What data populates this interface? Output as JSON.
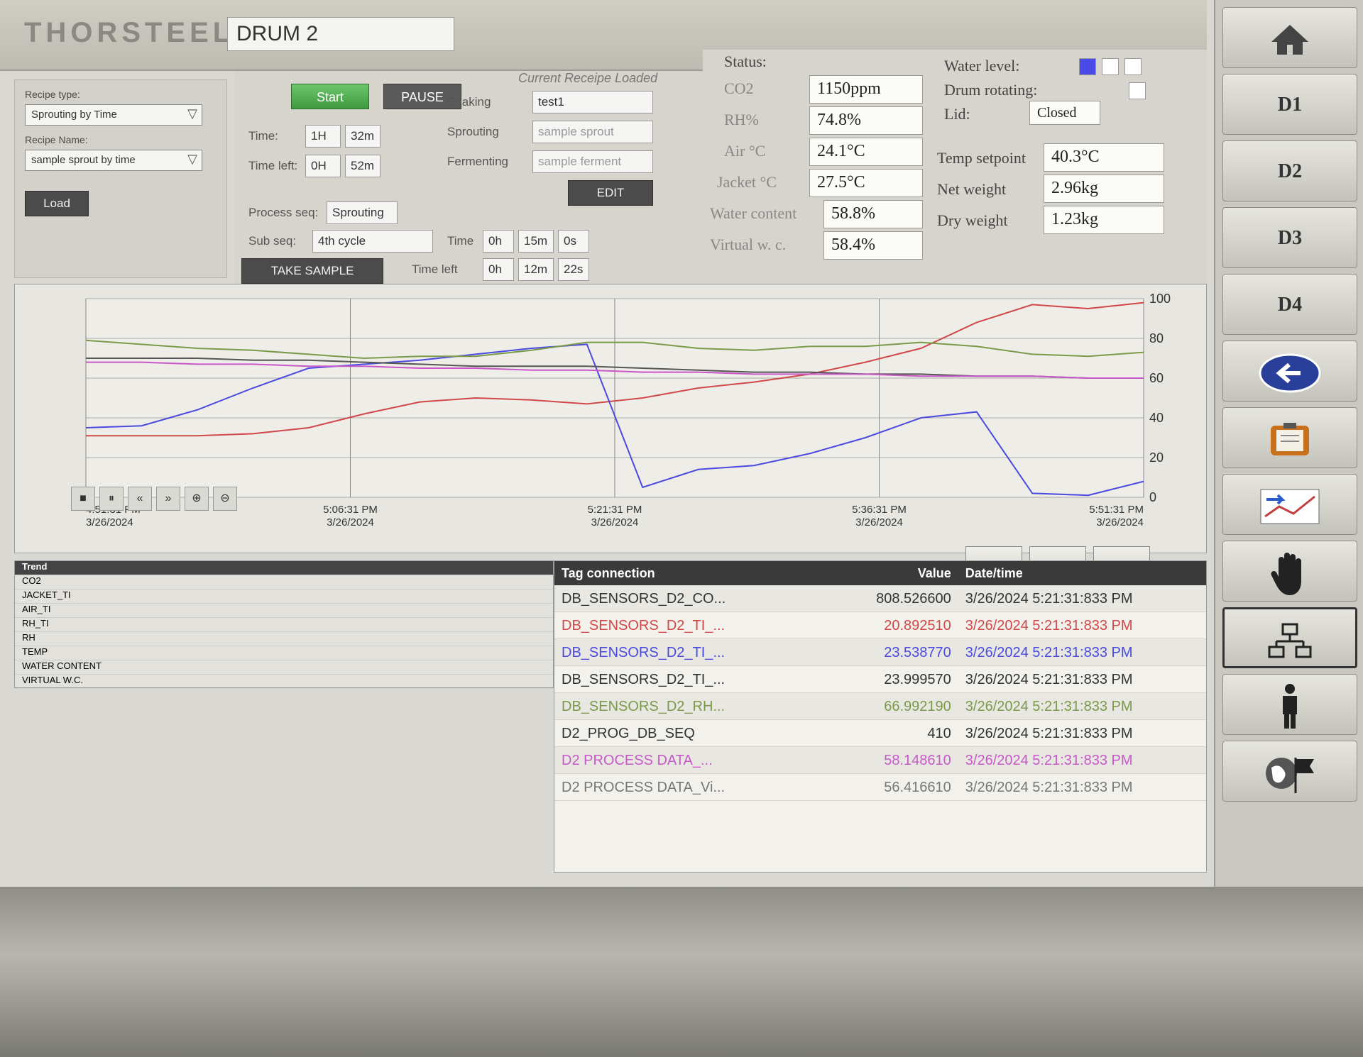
{
  "header": {
    "logo": "THORSTEEL",
    "drum_title": "DRUM 2"
  },
  "recipe_panel": {
    "recipe_type_label": "Recipe type:",
    "recipe_type_value": "Sprouting by Time",
    "recipe_name_label": "Recipe Name:",
    "recipe_name_value": "sample sprout by time",
    "load_label": "Load"
  },
  "process": {
    "start_label": "Start",
    "pause_label": "PAUSE",
    "time_label": "Time:",
    "time_h": "1H",
    "time_m": "32m",
    "time_left_label": "Time left:",
    "time_left_h": "0H",
    "time_left_m": "52m",
    "process_seq_label": "Process seq:",
    "process_seq_value": "Sprouting",
    "sub_seq_label": "Sub seq:",
    "sub_seq_value": "4th cycle",
    "take_sample_label": "TAKE SAMPLE",
    "sub_time_label": "Time",
    "sub_time_h": "0h",
    "sub_time_m": "15m",
    "sub_time_s": "0s",
    "sub_time_left_label": "Time left",
    "sub_time_left_h": "0h",
    "sub_time_left_m": "12m",
    "sub_time_left_s": "22s"
  },
  "current_recipe": {
    "title": "Current Receipe Loaded",
    "soaking_label": "Soaking",
    "soaking_value": "test1",
    "sprouting_label": "Sprouting",
    "sprouting_value": "sample sprout",
    "fermenting_label": "Fermenting",
    "fermenting_value": "sample ferment",
    "edit_label": "EDIT"
  },
  "status": {
    "title": "Status:",
    "co2_label": "CO2",
    "co2_value": "1150ppm",
    "rh_label": "RH%",
    "rh_value": "74.8%",
    "air_label": "Air °C",
    "air_value": "24.1°C",
    "jacket_label": "Jacket °C",
    "jacket_value": "27.5°C",
    "water_content_label": "Water content",
    "water_content_value": "58.8%",
    "virtual_wc_label": "Virtual w. c.",
    "virtual_wc_value": "58.4%",
    "water_level_label": "Water level:",
    "drum_rotating_label": "Drum rotating:",
    "lid_label": "Lid:",
    "lid_value": "Closed",
    "temp_setpoint_label": "Temp setpoint",
    "temp_setpoint_value": "40.3°C",
    "net_weight_label": "Net weight",
    "net_weight_value": "2.96kg",
    "dry_weight_label": "Dry weight",
    "dry_weight_value": "1.23kg"
  },
  "water_level": {
    "segments_filled": 1,
    "segments_total": 3,
    "fill_color": "#4a4ae8"
  },
  "nav": {
    "home_icon": "home-icon",
    "d1": "D1",
    "d2": "D2",
    "d3": "D3",
    "d4": "D4",
    "back_icon": "back-arrow-icon",
    "clipboard_icon": "clipboard-icon",
    "trend_icon": "trend-icon",
    "hand_icon": "manual-hand-icon",
    "network_icon": "network-icon",
    "person_icon": "person-icon",
    "globe_icon": "globe-flag-icon"
  },
  "chart_data": {
    "type": "line",
    "x_ticks": [
      {
        "time": "4:51:31 PM",
        "date": "3/26/2024"
      },
      {
        "time": "5:06:31 PM",
        "date": "3/26/2024"
      },
      {
        "time": "5:21:31 PM",
        "date": "3/26/2024"
      },
      {
        "time": "5:36:31 PM",
        "date": "3/26/2024"
      },
      {
        "time": "5:51:31 PM",
        "date": "3/26/2024"
      }
    ],
    "y_right_ticks": [
      0,
      20,
      40,
      60,
      80,
      100
    ],
    "ylim": [
      0,
      100
    ],
    "grid": true,
    "series": [
      {
        "color": "#d04848",
        "values": [
          31,
          31,
          31,
          32,
          35,
          42,
          48,
          50,
          49,
          47,
          50,
          55,
          58,
          62,
          68,
          75,
          88,
          97,
          95,
          98
        ]
      },
      {
        "color": "#4a4ae0",
        "values": [
          35,
          36,
          44,
          55,
          65,
          67,
          69,
          72,
          75,
          77,
          5,
          14,
          16,
          22,
          30,
          40,
          43,
          2,
          1,
          8
        ]
      },
      {
        "color": "#7a9a4a",
        "values": [
          79,
          77,
          75,
          74,
          72,
          70,
          71,
          71,
          74,
          78,
          78,
          75,
          74,
          76,
          76,
          78,
          76,
          72,
          71,
          73
        ]
      },
      {
        "color": "#555555",
        "values": [
          70,
          70,
          70,
          69,
          69,
          68,
          67,
          66,
          66,
          66,
          65,
          64,
          63,
          63,
          62,
          62,
          61,
          61,
          60,
          60
        ]
      },
      {
        "color": "#c858c8",
        "values": [
          68,
          68,
          67,
          67,
          66,
          66,
          65,
          65,
          64,
          64,
          63,
          63,
          62,
          62,
          62,
          61,
          61,
          61,
          60,
          60
        ]
      }
    ]
  },
  "toolbar": {
    "stop_icon": "stop-icon",
    "pause_icon": "pause-icon",
    "rewind_icon": "rewind-icon",
    "forward_icon": "forward-icon",
    "zoom_in_icon": "zoom-in-icon",
    "zoom_out_icon": "zoom-out-icon",
    "cursor_icon": "cursor-icon",
    "cursor_left_icon": "cursor-left-icon",
    "cursor_right_icon": "cursor-right-icon"
  },
  "legend": {
    "header": "Trend",
    "rows": [
      "CO2",
      "JACKET_TI",
      "AIR_TI",
      "RH_TI",
      "RH",
      "TEMP",
      "WATER CONTENT",
      "VIRTUAL W.C."
    ]
  },
  "table": {
    "headers": {
      "tag": "Tag connection",
      "value": "Value",
      "date": "Date/time"
    },
    "rows": [
      {
        "tag": "DB_SENSORS_D2_CO...",
        "value": "808.526600",
        "date": "3/26/2024 5:21:31:833 PM",
        "color": "#333333"
      },
      {
        "tag": "DB_SENSORS_D2_TI_...",
        "value": "20.892510",
        "date": "3/26/2024 5:21:31:833 PM",
        "color": "#d04848"
      },
      {
        "tag": "DB_SENSORS_D2_TI_...",
        "value": "23.538770",
        "date": "3/26/2024 5:21:31:833 PM",
        "color": "#4a4ae0"
      },
      {
        "tag": "DB_SENSORS_D2_TI_...",
        "value": "23.999570",
        "date": "3/26/2024 5:21:31:833 PM",
        "color": "#333333"
      },
      {
        "tag": "DB_SENSORS_D2_RH...",
        "value": "66.992190",
        "date": "3/26/2024 5:21:31:833 PM",
        "color": "#7a9a4a"
      },
      {
        "tag": "D2_PROG_DB_SEQ",
        "value": "410",
        "date": "3/26/2024 5:21:31:833 PM",
        "color": "#333333"
      },
      {
        "tag": "D2 PROCESS DATA_...",
        "value": "58.148610",
        "date": "3/26/2024 5:21:31:833 PM",
        "color": "#c858c8"
      },
      {
        "tag": "D2 PROCESS DATA_Vi...",
        "value": "56.416610",
        "date": "3/26/2024 5:21:31:833 PM",
        "color": "#777777"
      }
    ]
  }
}
